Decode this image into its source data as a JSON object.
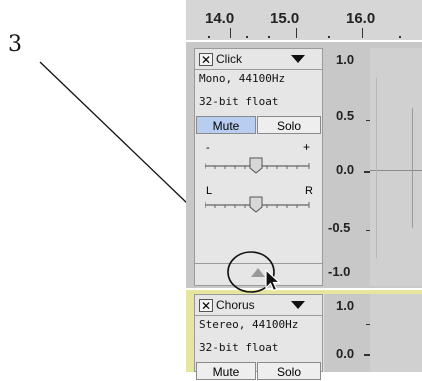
{
  "annotation": {
    "callout_number": "3"
  },
  "ruler": {
    "labels": [
      "14.0",
      "15.0",
      "16.0"
    ]
  },
  "tracks": [
    {
      "name": "Click",
      "info": [
        "Mono, 44100Hz",
        "32-bit float"
      ],
      "mute": "Mute",
      "solo": "Solo",
      "gain": {
        "minus": "-",
        "plus": "+"
      },
      "pan": {
        "left": "L",
        "right": "R"
      },
      "scale": [
        "1.0",
        "0.5",
        "0.0",
        "-0.5",
        "-1.0"
      ]
    },
    {
      "name": "Chorus",
      "info": [
        "Stereo, 44100Hz",
        "32-bit float"
      ],
      "mute": "Mute",
      "solo": "Solo",
      "scale": [
        "1.0",
        "0.0"
      ]
    }
  ],
  "colors": {
    "selected_track_border": "#e6e6a0",
    "mute_active": "#b9cdf0"
  }
}
